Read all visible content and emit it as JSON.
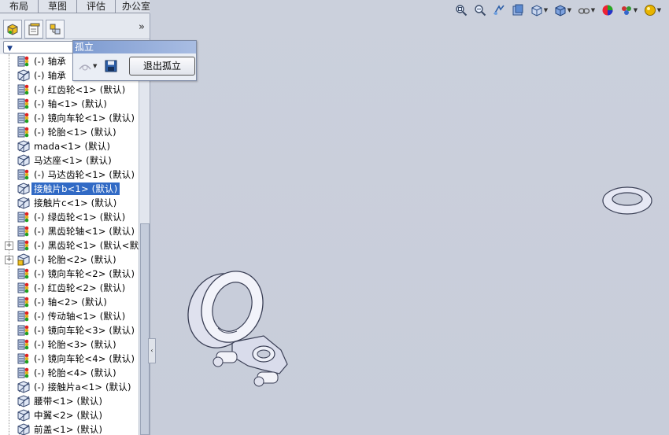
{
  "tabs": [
    "布局",
    "草图",
    "评估",
    "办公室产品"
  ],
  "hud_icons": [
    "zoom-to-fit-icon",
    "zoom-area-icon",
    "previous-view-icon",
    "section-view-icon",
    "view-orientation-icon",
    "display-style-icon",
    "hide-show-items-icon",
    "edit-appearance-icon",
    "apply-scene-icon",
    "view-settings-icon"
  ],
  "panel": {
    "tab_icons": [
      "feature-manager-icon",
      "property-manager-icon",
      "configuration-manager-icon"
    ],
    "expand_label": "»"
  },
  "isolate": {
    "title": "孤立",
    "exit_label": "退出孤立"
  },
  "tree": [
    {
      "label": "(-) 轴承",
      "icon": "part-color-icon",
      "expand": false
    },
    {
      "label": "(-) 轴承",
      "icon": "part-hidden-icon",
      "expand": false
    },
    {
      "label": "(-) 红齿轮<1> (默认)",
      "icon": "part-color-icon",
      "expand": false
    },
    {
      "label": "(-) 轴<1> (默认)",
      "icon": "part-color-icon",
      "expand": false
    },
    {
      "label": "(-) 镜向车轮<1> (默认)",
      "icon": "part-color-icon",
      "expand": false
    },
    {
      "label": "(-) 轮胎<1> (默认)",
      "icon": "part-color-icon",
      "expand": false
    },
    {
      "label": "mada<1> (默认)",
      "icon": "part-hidden-icon",
      "expand": false
    },
    {
      "label": "马达座<1> (默认)",
      "icon": "part-hidden-icon",
      "expand": false
    },
    {
      "label": "(-) 马达齿轮<1> (默认)",
      "icon": "part-color-icon",
      "expand": false
    },
    {
      "label": "接触片b<1> (默认)",
      "icon": "part-hidden-icon",
      "expand": false,
      "selected": true
    },
    {
      "label": "接触片c<1> (默认)",
      "icon": "part-hidden-icon",
      "expand": false
    },
    {
      "label": "(-) 绿齿轮<1> (默认)",
      "icon": "part-color-icon",
      "expand": false
    },
    {
      "label": "(-) 黑齿轮轴<1> (默认)",
      "icon": "part-color-icon",
      "expand": false
    },
    {
      "label": "(-) 黑齿轮<1> (默认<默",
      "icon": "part-color-icon",
      "expand": true
    },
    {
      "label": "(-) 轮胎<2> (默认)",
      "icon": "part-warning-icon",
      "expand": true
    },
    {
      "label": "(-) 镜向车轮<2> (默认)",
      "icon": "part-color-icon",
      "expand": false
    },
    {
      "label": "(-) 红齿轮<2> (默认)",
      "icon": "part-color-icon",
      "expand": false
    },
    {
      "label": "(-) 轴<2> (默认)",
      "icon": "part-color-icon",
      "expand": false
    },
    {
      "label": "(-) 传动轴<1> (默认)",
      "icon": "part-color-icon",
      "expand": false
    },
    {
      "label": "(-) 镜向车轮<3> (默认)",
      "icon": "part-color-icon",
      "expand": false
    },
    {
      "label": "(-) 轮胎<3> (默认)",
      "icon": "part-color-icon",
      "expand": false
    },
    {
      "label": "(-) 镜向车轮<4> (默认)",
      "icon": "part-color-icon",
      "expand": false
    },
    {
      "label": "(-) 轮胎<4> (默认)",
      "icon": "part-color-icon",
      "expand": false
    },
    {
      "label": "(-) 接触片a<1> (默认)",
      "icon": "part-hidden-icon",
      "expand": false
    },
    {
      "label": "腰带<1> (默认)",
      "icon": "part-hidden-icon",
      "expand": false
    },
    {
      "label": "中翼<2> (默认)",
      "icon": "part-hidden-icon",
      "expand": false
    },
    {
      "label": "前盖<1> (默认)",
      "icon": "part-hidden-icon",
      "expand": false
    }
  ]
}
